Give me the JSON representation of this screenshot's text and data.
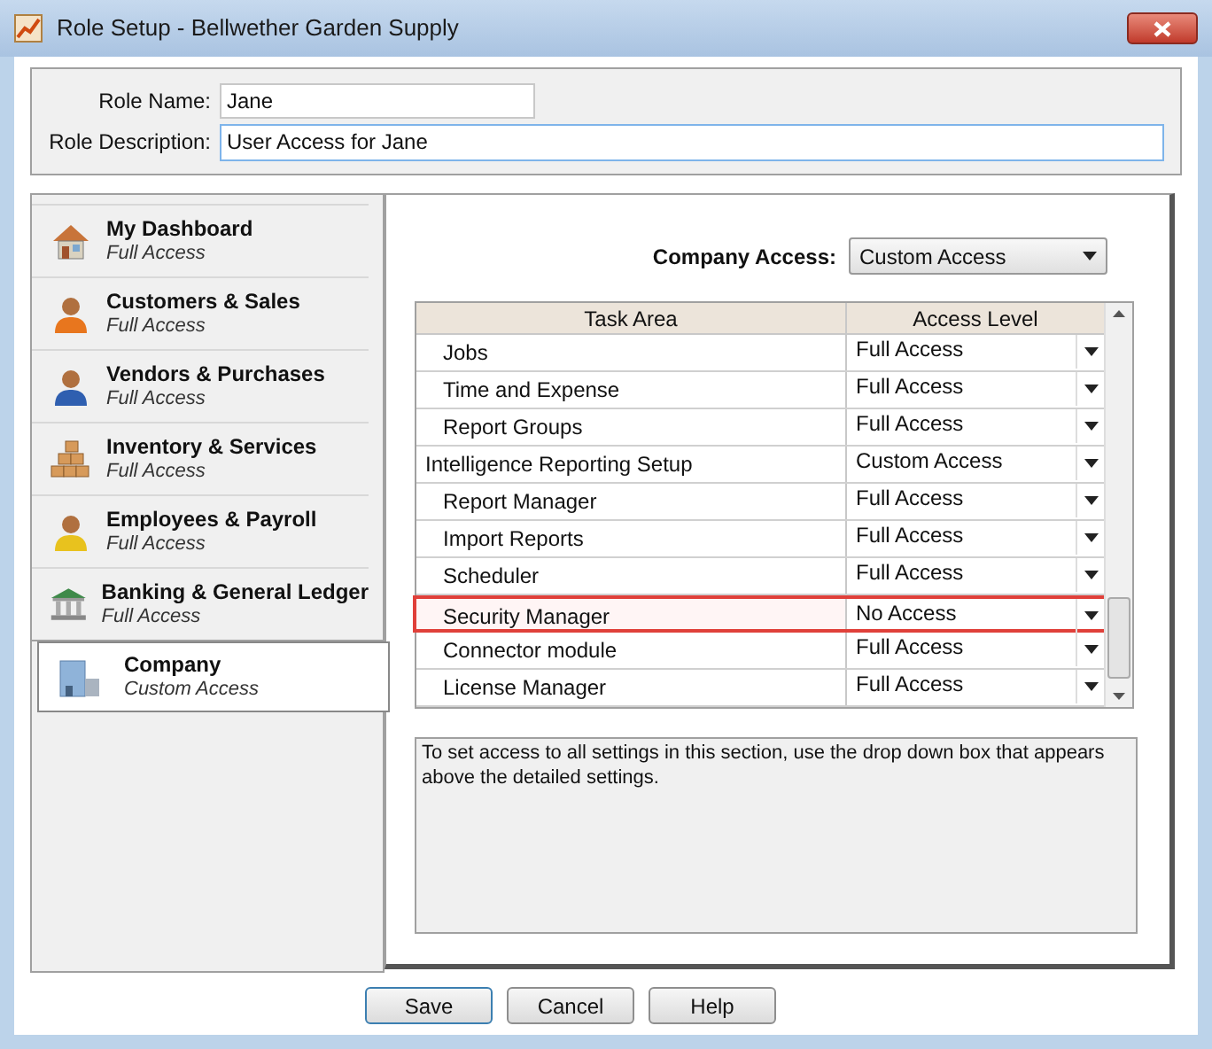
{
  "window": {
    "title": "Role Setup - Bellwether Garden Supply"
  },
  "role_name": {
    "label": "Role Name:",
    "value": "Jane"
  },
  "role_description": {
    "label": "Role Description:",
    "value": "User Access for Jane"
  },
  "sidebar": {
    "items": [
      {
        "title": "My Dashboard",
        "access": "Full Access",
        "selected": false
      },
      {
        "title": "Customers & Sales",
        "access": "Full Access",
        "selected": false
      },
      {
        "title": "Vendors & Purchases",
        "access": "Full Access",
        "selected": false
      },
      {
        "title": "Inventory & Services",
        "access": "Full Access",
        "selected": false
      },
      {
        "title": "Employees & Payroll",
        "access": "Full Access",
        "selected": false
      },
      {
        "title": "Banking & General Ledger",
        "access": "Full Access",
        "selected": false
      },
      {
        "title": "Company",
        "access": "Custom Access",
        "selected": true
      }
    ]
  },
  "company_access": {
    "label": "Company Access:",
    "value": "Custom Access"
  },
  "table": {
    "columns": [
      "Task Area",
      "Access Level"
    ],
    "rows": [
      {
        "task": "Jobs",
        "kind": "task",
        "access": "Full Access",
        "selected": false
      },
      {
        "task": "Time and Expense",
        "kind": "task",
        "access": "Full Access",
        "selected": false
      },
      {
        "task": "Report Groups",
        "kind": "task",
        "access": "Full Access",
        "selected": false
      },
      {
        "task": "Intelligence Reporting Setup",
        "kind": "group",
        "access": "Custom Access",
        "selected": false
      },
      {
        "task": "Report Manager",
        "kind": "task",
        "access": "Full Access",
        "selected": false
      },
      {
        "task": "Import Reports",
        "kind": "task",
        "access": "Full Access",
        "selected": false
      },
      {
        "task": "Scheduler",
        "kind": "task",
        "access": "Full Access",
        "selected": false
      },
      {
        "task": "Security Manager",
        "kind": "task",
        "access": "No Access",
        "selected": true
      },
      {
        "task": "Connector module",
        "kind": "task",
        "access": "Full Access",
        "selected": false
      },
      {
        "task": "License Manager",
        "kind": "task",
        "access": "Full Access",
        "selected": false
      }
    ]
  },
  "help_text": "To set access to all settings in this section, use the drop down box that appears above the detailed settings.",
  "buttons": [
    "Save",
    "Cancel",
    "Help"
  ]
}
